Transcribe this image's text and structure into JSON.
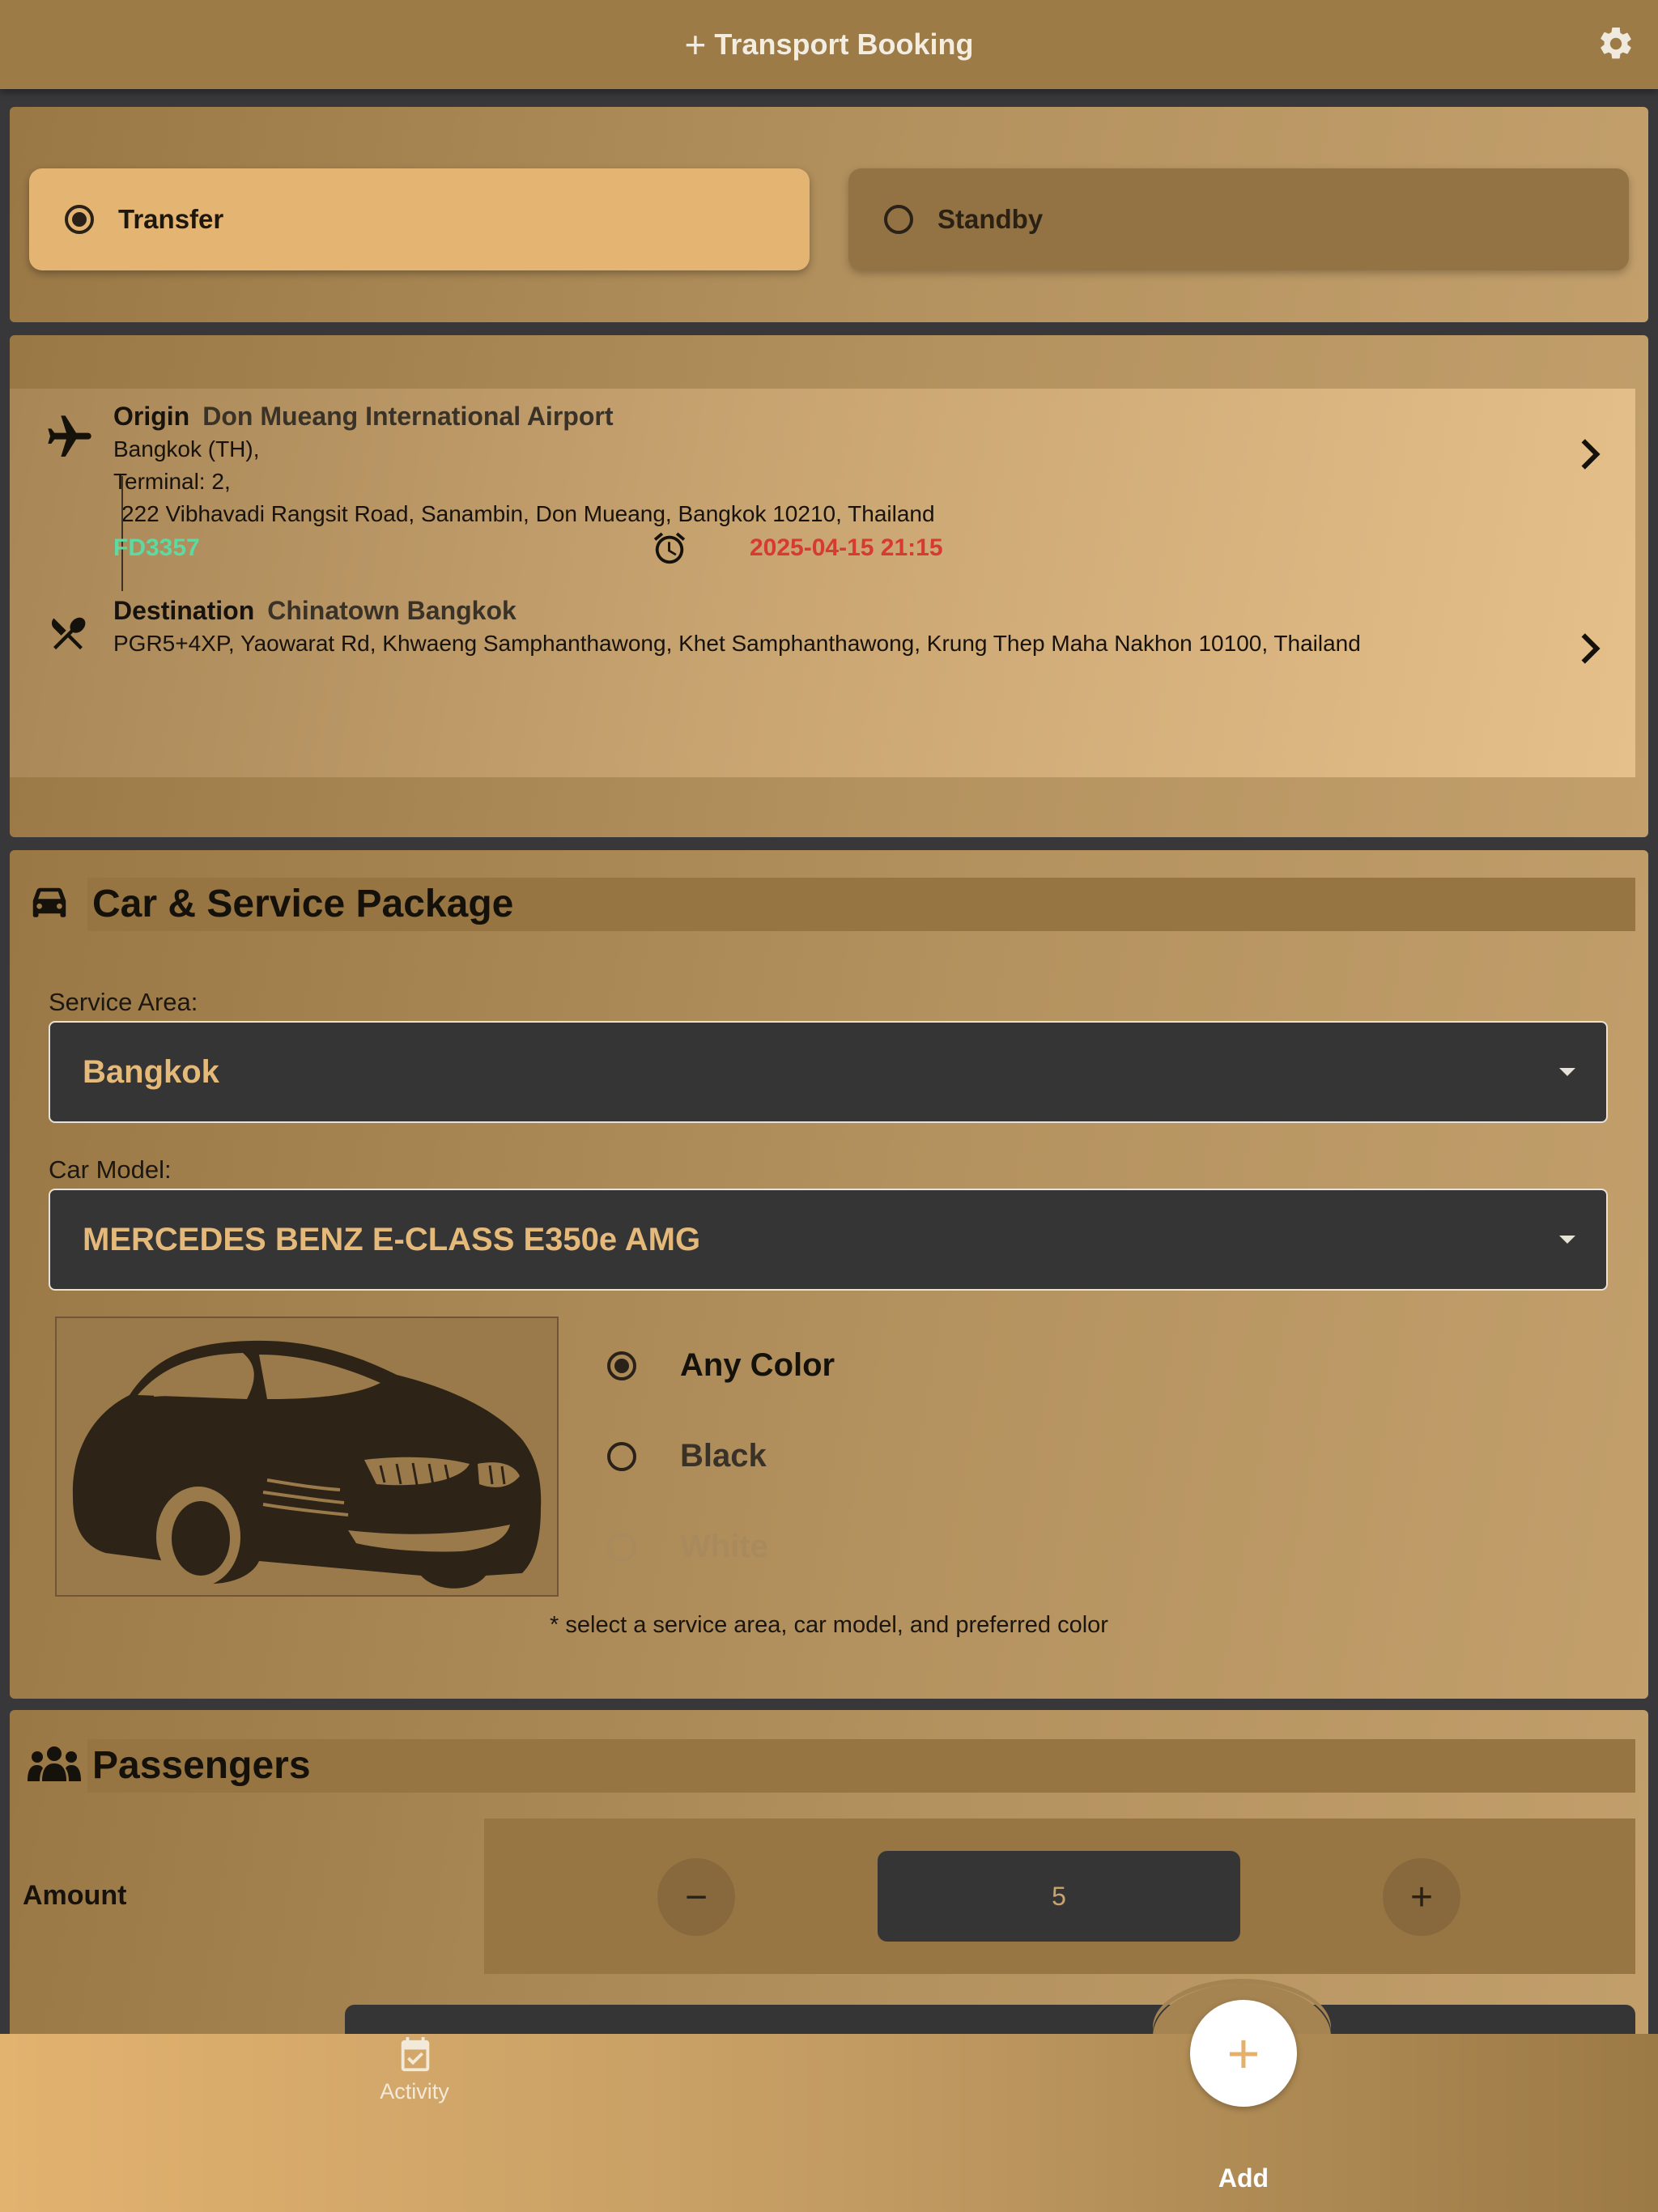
{
  "appbar": {
    "title": "Transport Booking",
    "plus": "+"
  },
  "mode": {
    "options": [
      {
        "label": "Transfer",
        "selected": true
      },
      {
        "label": "Standby",
        "selected": false
      }
    ]
  },
  "origin": {
    "label": "Origin",
    "place": "Don Mueang International Airport",
    "lines": [
      "Bangkok (TH),",
      "Terminal: 2,",
      "222 Vibhavadi Rangsit Road, Sanambin, Don Mueang, Bangkok 10210, Thailand"
    ],
    "flight": "FD3357",
    "datetime": "2025-04-15 21:15"
  },
  "destination": {
    "label": "Destination",
    "place": "Chinatown Bangkok",
    "address": "PGR5+4XP, Yaowarat Rd, Khwaeng Samphanthawong, Khet Samphanthawong, Krung Thep Maha Nakhon 10100, Thailand"
  },
  "car": {
    "title": "Car & Service Package",
    "service_area_label": "Service Area:",
    "service_area": "Bangkok",
    "car_model_label": "Car Model:",
    "car_model": "MERCEDES BENZ E-CLASS E350e AMG",
    "colors": [
      {
        "label": "Any Color",
        "selected": true,
        "enabled": true
      },
      {
        "label": "Black",
        "selected": false,
        "enabled": true
      },
      {
        "label": "White",
        "selected": false,
        "enabled": false
      }
    ],
    "hint": "* select a service area, car model, and preferred color"
  },
  "passengers": {
    "title": "Passengers",
    "amount_label": "Amount",
    "amount": "5",
    "minus": "−",
    "plus": "+"
  },
  "nav": {
    "activity": "Activity",
    "add": "Add",
    "fab_icon": "+"
  },
  "colors": {
    "accent": "#e4b572",
    "dark": "#363536",
    "flight": "#5fd9a2",
    "datetime": "#d63a30"
  }
}
